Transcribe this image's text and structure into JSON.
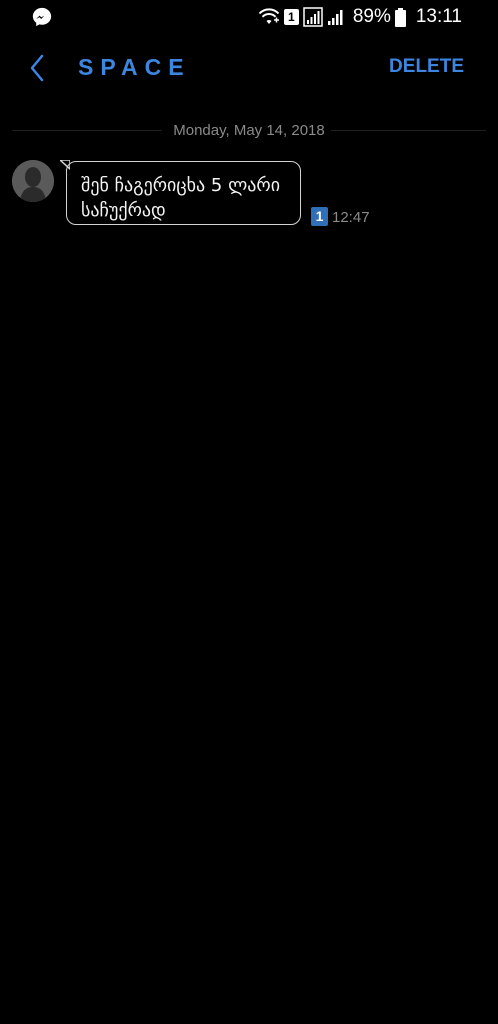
{
  "status_bar": {
    "sim_label": "1",
    "battery": "89%",
    "time": "13:11",
    "icons": [
      "messenger-icon",
      "wifi-icon",
      "signal-icon",
      "battery-icon"
    ]
  },
  "header": {
    "title": "SPACE",
    "delete_label": "DELETE",
    "accent_color": "#3d86e0"
  },
  "conversation": {
    "date": "Monday, May 14, 2018",
    "messages": [
      {
        "text": "შენ ჩაგერიცხა 5 ლარი საჩუქრად",
        "sim": "1",
        "time": "12:47"
      }
    ]
  }
}
